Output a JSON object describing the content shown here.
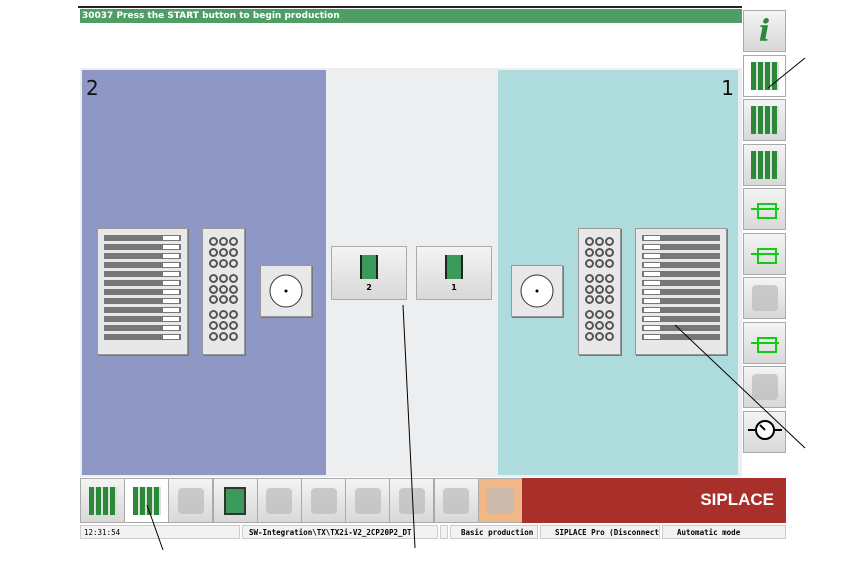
{
  "message": "30037 Press the START button to begin production",
  "stations": {
    "left": "2",
    "right": "1"
  },
  "conveyor": [
    {
      "label": "2"
    },
    {
      "label": "1"
    }
  ],
  "right_toolbar": [
    "info-icon",
    "placement-grid-icon",
    "feeder-list-icon",
    "component-list-icon",
    "camera-calibration-icon",
    "vision-calibration-icon",
    "user-lock-icon",
    "pcb-position-icon",
    "user-settings-icon",
    "gauge-icon"
  ],
  "bottom_toolbar": [
    "pcb-stack-icon",
    "feeder-table-icon",
    "bar-chart-icon",
    "pcb-icon",
    "alarm-icon",
    "trend-chart-icon",
    "camera-icon",
    "tools-icon",
    "hand-gear-icon",
    "oil-can-icon"
  ],
  "brand": "SIPLACE",
  "status": {
    "time": "12:31:54",
    "path": "SW-Integration\\TX\\TX2i-V2_2CP20P2_DT",
    "mode": "Basic production",
    "connection": "SIPLACE Pro (Disconnected)",
    "operation": "Automatic mode"
  },
  "colors": {
    "message_bar": "#4e9e66",
    "station2": "#8f98c4",
    "station1": "#aedcdc",
    "brand": "#a9302a"
  }
}
